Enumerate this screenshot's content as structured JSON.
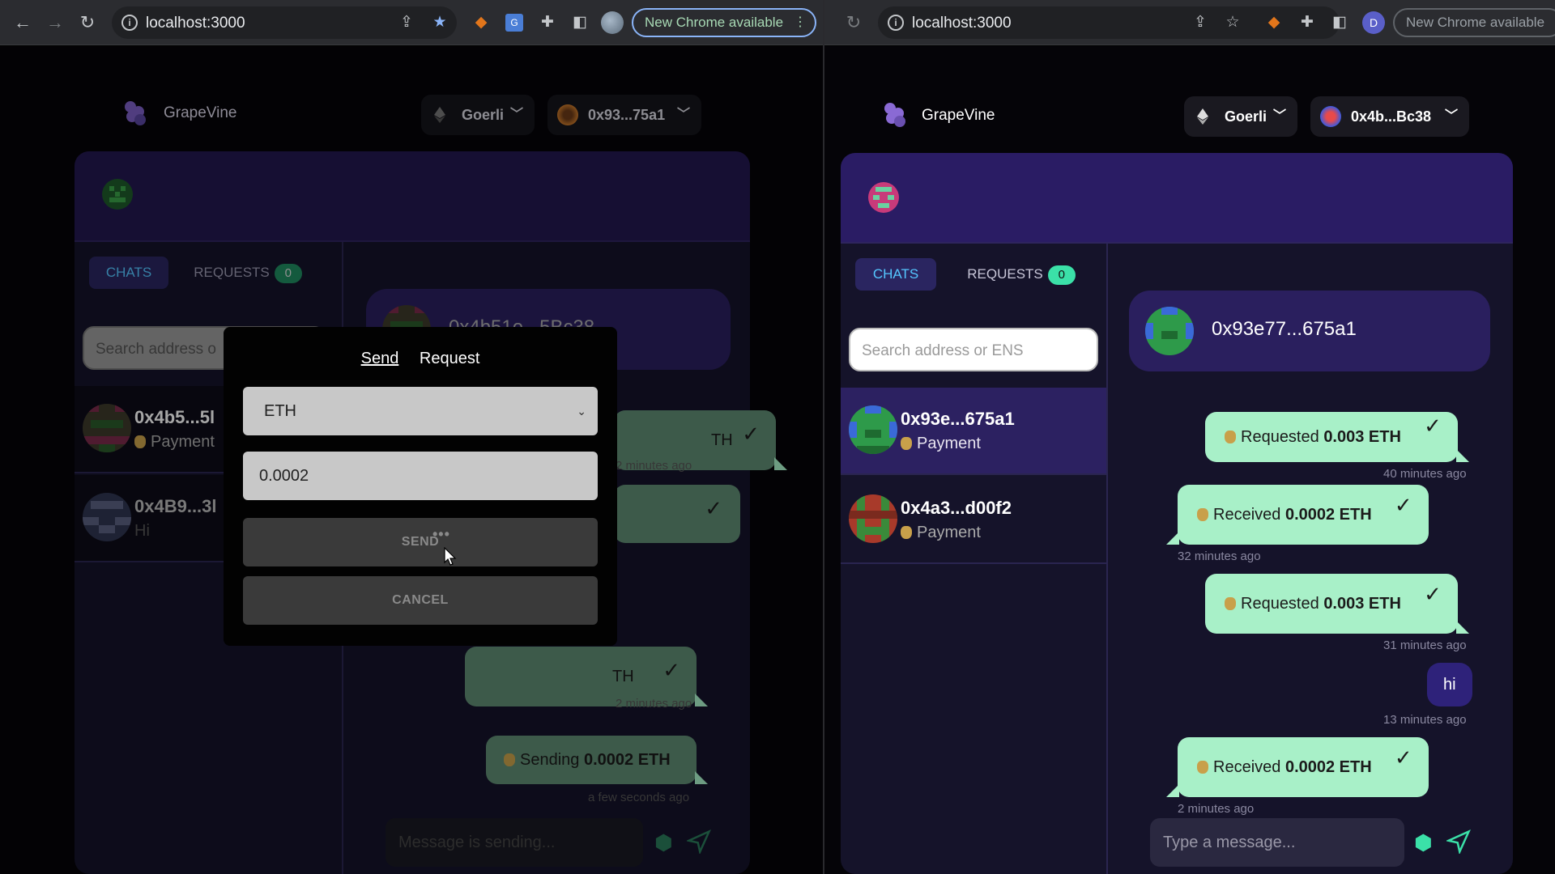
{
  "left_window": {
    "browser": {
      "url": "localhost:3000",
      "new_chrome": "New Chrome available"
    },
    "app": {
      "brand": "GrapeVine",
      "network": "Goerli",
      "account": "0x93...75a1",
      "tabs": {
        "chats": "CHATS",
        "requests": "REQUESTS",
        "requests_count": "0"
      },
      "search_placeholder": "Search address o",
      "contacts": [
        {
          "name": "0x4b5...5l",
          "sub": "Payment"
        },
        {
          "name": "0x4B9...3l",
          "sub": "Hi"
        }
      ],
      "chat_header": "0x4b51e...5Bc38",
      "messages": [
        {
          "text": "TH",
          "time": "2 minutes ago"
        },
        {
          "text": "",
          "time": ""
        },
        {
          "text": "TH",
          "time": "2 minutes ago"
        },
        {
          "prefix": "Sending",
          "amount": "0.0002 ETH",
          "time": "a few seconds ago"
        }
      ],
      "message_placeholder": "Message is sending..."
    },
    "modal": {
      "tab_send": "Send",
      "tab_request": "Request",
      "currency": "ETH",
      "amount": "0.0002",
      "send_label": "SEND",
      "cancel_label": "CANCEL"
    }
  },
  "right_window": {
    "browser": {
      "url": "localhost:3000",
      "new_chrome": "New Chrome available",
      "profile": "D"
    },
    "app": {
      "brand": "GrapeVine",
      "network": "Goerli",
      "account": "0x4b...Bc38",
      "tabs": {
        "chats": "CHATS",
        "requests": "REQUESTS",
        "requests_count": "0"
      },
      "search_placeholder": "Search address or ENS",
      "contacts": [
        {
          "name": "0x93e...675a1",
          "sub": "Payment"
        },
        {
          "name": "0x4a3...d00f2",
          "sub": "Payment"
        }
      ],
      "chat_header": "0x93e77...675a1",
      "messages": [
        {
          "prefix": "Requested",
          "amount": "0.003 ETH",
          "time": "40 minutes ago"
        },
        {
          "prefix": "Received",
          "amount": "0.0002 ETH",
          "time": "32 minutes ago"
        },
        {
          "prefix": "Requested",
          "amount": "0.003 ETH",
          "time": "31 minutes ago"
        },
        {
          "text": "hi",
          "time": "13 minutes ago"
        },
        {
          "prefix": "Received",
          "amount": "0.0002 ETH",
          "time": "2 minutes ago"
        }
      ],
      "message_placeholder": "Type a message..."
    }
  },
  "colors": {
    "accent_green": "#a8f0c8",
    "accent_blue": "#55c7ff",
    "panel_purple": "#22174f"
  }
}
